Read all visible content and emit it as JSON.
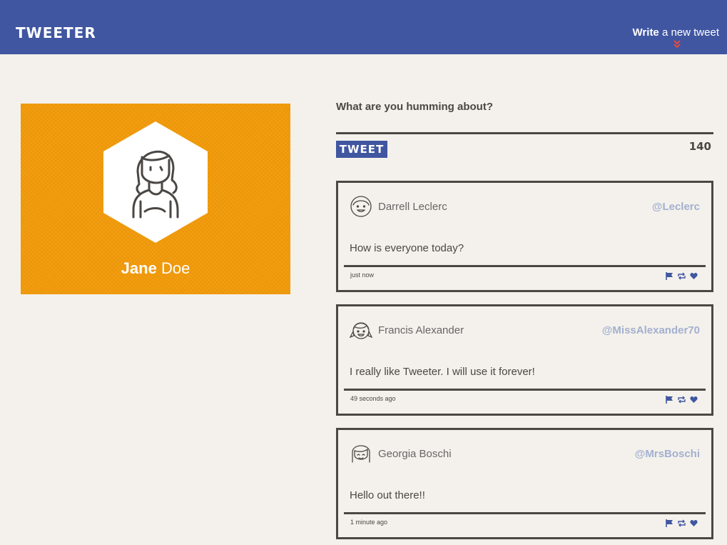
{
  "nav": {
    "brand": "TWEETER",
    "compose_bold": "Write",
    "compose_rest": " a new tweet"
  },
  "profile": {
    "first_name": "Jane",
    "last_name": "Doe"
  },
  "composer": {
    "prompt": "What are you humming about?",
    "button_label": "TWEET",
    "counter": "140"
  },
  "tweets": [
    {
      "name": "Darrell Leclerc",
      "handle": "@Leclerc",
      "body": "How is everyone today?",
      "time": "just now",
      "avatar": "man-face-icon"
    },
    {
      "name": "Francis Alexander",
      "handle": "@MissAlexander70",
      "body": "I really like Tweeter. I will use it forever!",
      "time": "49 seconds ago",
      "avatar": "girl-pigtails-face-icon"
    },
    {
      "name": "Georgia Boschi",
      "handle": "@MrsBoschi",
      "body": "Hello out there!!",
      "time": "1 minute ago",
      "avatar": "woman-bangs-face-icon"
    }
  ],
  "colors": {
    "nav_bg": "#4056a1",
    "profile_bg": "#f19a0a",
    "page_bg": "#f4f1ec",
    "text": "#4a4744",
    "handle": "#a3b0cf",
    "accent_red": "#e74c3c"
  }
}
